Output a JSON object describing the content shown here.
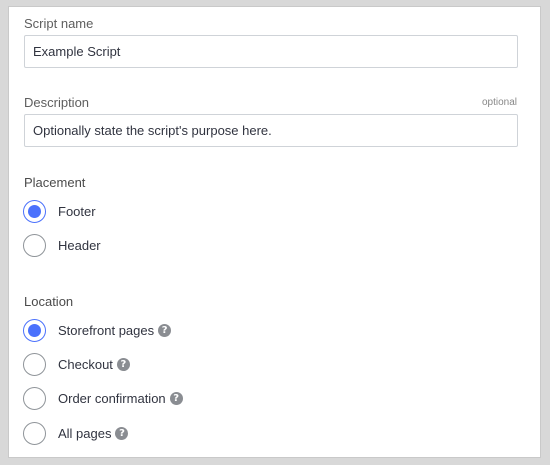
{
  "script_name": {
    "label": "Script name",
    "value": "Example Script"
  },
  "description": {
    "label": "Description",
    "optional_label": "optional",
    "placeholder": "Optionally state the script's purpose here."
  },
  "placement": {
    "label": "Placement",
    "options": [
      {
        "label": "Footer",
        "checked": true
      },
      {
        "label": "Header",
        "checked": false
      }
    ]
  },
  "location": {
    "label": "Location",
    "options": [
      {
        "label": "Storefront pages",
        "checked": true,
        "help_icon": "question-circle-icon"
      },
      {
        "label": "Checkout",
        "checked": false,
        "help_icon": "question-circle-icon"
      },
      {
        "label": "Order confirmation",
        "checked": false,
        "help_icon": "question-circle-icon"
      },
      {
        "label": "All pages",
        "checked": false,
        "help_icon": "question-circle-icon"
      }
    ]
  },
  "colors": {
    "accent": "#4b71fc",
    "help_icon": "#8a8d92"
  }
}
